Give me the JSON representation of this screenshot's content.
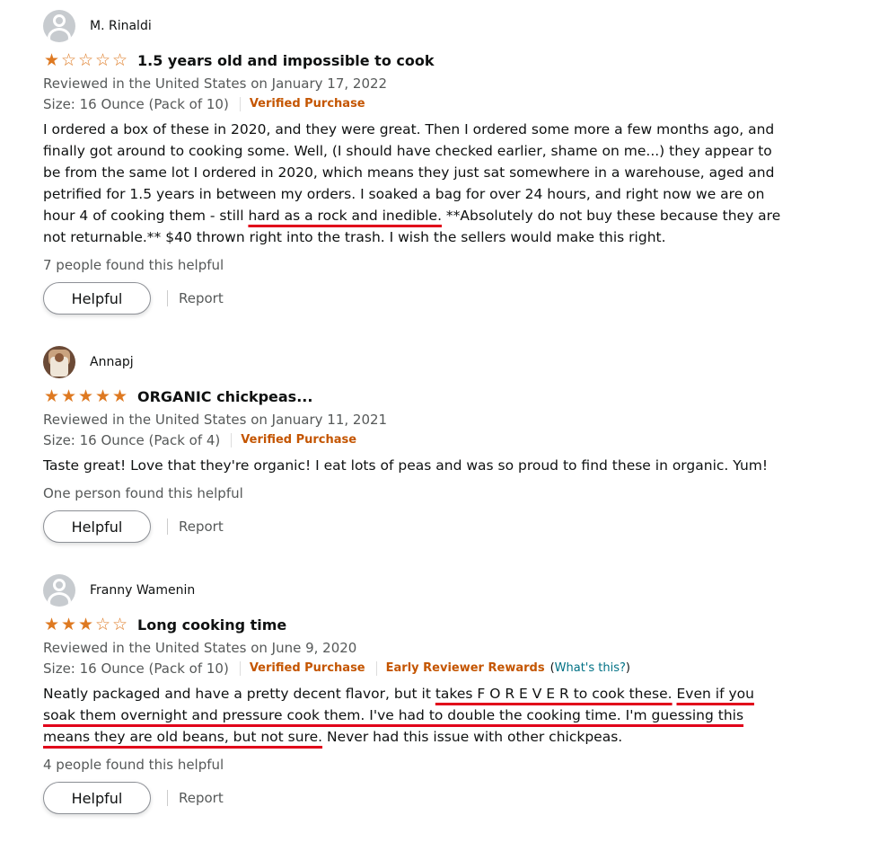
{
  "reviews": [
    {
      "reviewer": "M. Rinaldi",
      "avatar": "default",
      "rating": 1,
      "title": "1.5 years old and impossible to cook",
      "reviewed_on": "Reviewed in the United States on January 17, 2022",
      "size": "Size: 16 Ounce (Pack of 10)",
      "verified": "Verified Purchase",
      "body_parts": [
        {
          "text": "I ordered a box of these in 2020, and they were great. Then I ordered some more a few months ago, and finally got around to cooking some. Well, (I should have checked earlier, shame on me...) they appear to be from the same lot I ordered in 2020, which means they just sat somewhere in a warehouse, aged and petrified for 1.5 years in between my orders. I soaked a bag for over 24 hours, and right now we are on hour 4 of cooking them - still "
        },
        {
          "text": "hard as a rock and inedible.",
          "underline": true
        },
        {
          "text": " **Absolutely do not buy these because they are not returnable.** $40 thrown right into the trash. I wish the sellers would make this right."
        }
      ],
      "helpful_count": "7 people found this helpful",
      "helpful_label": "Helpful",
      "report_label": "Report"
    },
    {
      "reviewer": "Annapj",
      "avatar": "photo",
      "rating": 5,
      "title": "ORGANIC chickpeas...",
      "reviewed_on": "Reviewed in the United States on January 11, 2021",
      "size": "Size: 16 Ounce (Pack of 4)",
      "verified": "Verified Purchase",
      "body_parts": [
        {
          "text": "Taste great! Love that they're organic! I eat lots of peas and was so proud to find these in organic. Yum!"
        }
      ],
      "helpful_count": "One person found this helpful",
      "helpful_label": "Helpful",
      "report_label": "Report"
    },
    {
      "reviewer": "Franny Wamenin",
      "avatar": "default",
      "rating": 3,
      "title": "Long cooking time",
      "reviewed_on": "Reviewed in the United States on June 9, 2020",
      "size": "Size: 16 Ounce (Pack of 10)",
      "verified": "Verified Purchase",
      "early_reviewer": "Early Reviewer Rewards",
      "whats_this_open": "(",
      "whats_this": "What's this?",
      "whats_this_close": ")",
      "body_parts": [
        {
          "text": "Neatly packaged and have a pretty decent flavor, but it "
        },
        {
          "text": "takes F O R E V E R to cook these.",
          "underline": true
        },
        {
          "text": " "
        },
        {
          "text": "Even if you soak them overnight and pressure cook them. I've had to double the cooking time. I'm guessing this means they are old beans, but not sure.",
          "underline": true
        },
        {
          "text": " Never had this issue with other chickpeas."
        }
      ],
      "helpful_count": "4 people found this helpful",
      "helpful_label": "Helpful",
      "report_label": "Report"
    }
  ],
  "colors": {
    "star": "#de7921",
    "verified": "#c45500",
    "link": "#007185",
    "underline_annotation": "#e1001a"
  },
  "icons": {
    "star_full": "★",
    "star_empty": "☆"
  }
}
